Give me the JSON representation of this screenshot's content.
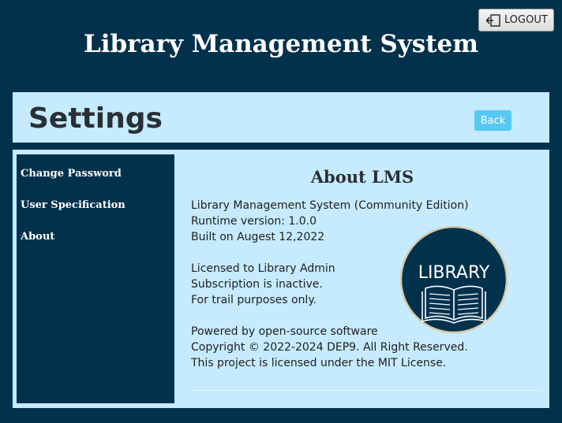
{
  "header": {
    "logout_label": "LOGOUT",
    "logout_icon": "logout-icon",
    "app_title": "Library Management System"
  },
  "settings": {
    "title": "Settings",
    "back_label": "Back"
  },
  "sidebar": {
    "items": [
      {
        "label": "Change Password"
      },
      {
        "label": "User Specification"
      },
      {
        "label": "About"
      }
    ]
  },
  "about": {
    "title": "About LMS",
    "lines": [
      "Library Management System (Community Edition)",
      "Runtime version: 1.0.0",
      "Built on Augest 12,2022",
      "Licensed to Library Admin",
      "Subscription is inactive.",
      "For trail purposes only.",
      "Powered by open-source software",
      "Copyright © 2022-2024 DEP9. All Right Reserved.",
      "This project is licensed under the MIT License."
    ],
    "logo_text": "LIBRARY",
    "logo_icon": "open-book-icon"
  },
  "colors": {
    "background": "#02314c",
    "panel": "#c6ebff",
    "accent": "#58c8f5"
  }
}
